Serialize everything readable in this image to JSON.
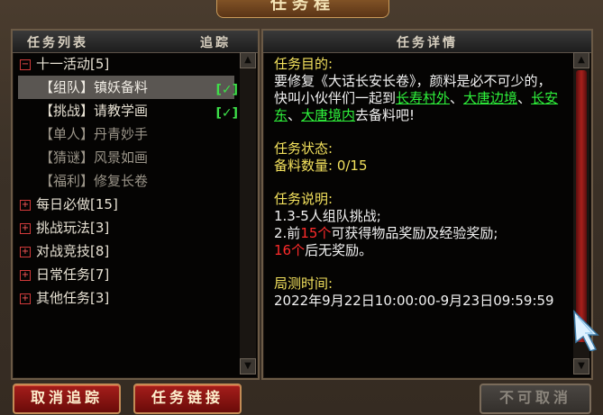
{
  "window": {
    "title": "任务程"
  },
  "left_panel": {
    "header_title": "任务列表",
    "header_track": "追踪",
    "tree": [
      {
        "label": "十一活动[5]",
        "expanded": true,
        "children": [
          {
            "label": "【组队】镇妖备料",
            "tracked": true,
            "selected": true
          },
          {
            "label": "【挑战】请教学画",
            "tracked": true
          },
          {
            "label": "【单人】丹青妙手",
            "tracked": false
          },
          {
            "label": "【猜谜】风景如画",
            "tracked": false
          },
          {
            "label": "【福利】修复长卷",
            "tracked": false
          }
        ]
      },
      {
        "label": "每日必做[15]",
        "expanded": false
      },
      {
        "label": "挑战玩法[3]",
        "expanded": false
      },
      {
        "label": "对战竞技[8]",
        "expanded": false
      },
      {
        "label": "日常任务[7]",
        "expanded": false
      },
      {
        "label": "其他任务[3]",
        "expanded": false
      }
    ],
    "track_mark": "[✓]"
  },
  "right_panel": {
    "header_title": "任务详情",
    "goal_title": "任务目的:",
    "goal_text_1": "要修复《大话长安长卷》，颜料是必不可少的，快叫小伙伴们一起到",
    "goal_link_1": "长寿村外",
    "goal_sep_1": "、",
    "goal_link_2": "大唐边境",
    "goal_sep_2": "、",
    "goal_link_3": "长安东",
    "goal_sep_3": "、",
    "goal_link_4": "大唐境内",
    "goal_text_2": "去备料吧!",
    "status_title": "任务状态:",
    "status_text": "备料数量: 0/15",
    "desc_title": "任务说明:",
    "desc_line_1": "1.3-5人组队挑战;",
    "desc_line_2_a": "2.前",
    "desc_line_2_red": "15个",
    "desc_line_2_b": "可获得物品奖励及经验奖励;",
    "desc_line_3_red": "16个",
    "desc_line_3_b": "后无奖励。",
    "time_title": "局测时间:",
    "time_text": "2022年9月22日10:00:00-9月23日09:59:59"
  },
  "buttons": {
    "cancel_track": "取消追踪",
    "task_link": "任务链接",
    "cannot_cancel": "不可取消"
  },
  "colors": {
    "track_green": "#3ee04a",
    "link_green": "#2ef23b",
    "title_yellow": "#f3e15d",
    "highlight_red": "#ff2b2b",
    "button_red": "#a61e1b"
  }
}
